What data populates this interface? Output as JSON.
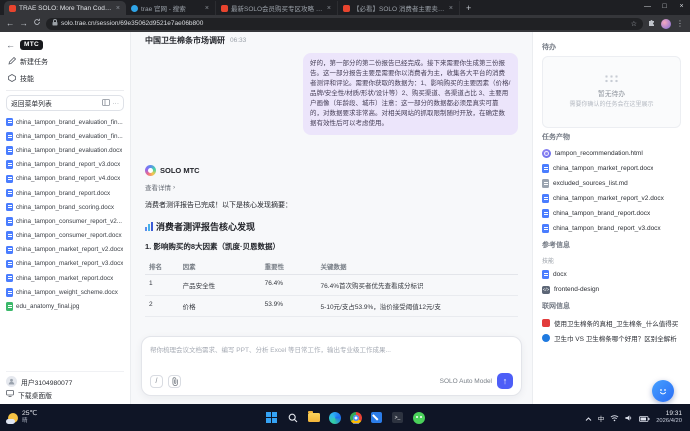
{
  "glyphs": {
    "back": "←",
    "forward": "→",
    "plus": "+",
    "min": "—",
    "max": "□",
    "close": "×",
    "more_v": "⋮",
    "more_h": "···",
    "chevron": "›",
    "up_arrow": "↑",
    "star": "☆",
    "slash": "/"
  },
  "browser": {
    "tabs": [
      {
        "title": "TRAE SOLO: More Than Coding"
      },
      {
        "title": "trae 官网 - 搜索"
      },
      {
        "title": "最新SOLO会员购买专区攻略 - TRAE..."
      },
      {
        "title": "【必看】SOLO 消费者主要卖点..."
      }
    ],
    "url": "solo.trae.cn/session/69e35062d9521e7ae06b800"
  },
  "sidebar": {
    "logo": "MTC",
    "new_task": "新建任务",
    "skills": "技能",
    "menu_button": "返回菜单列表",
    "files": [
      "china_tampon_brand_evaluation_fin...",
      "china_tampon_brand_evaluation_fin...",
      "china_tampon_brand_evaluation.docx",
      "china_tampon_brand_report_v3.docx",
      "china_tampon_brand_report_v4.docx",
      "china_tampon_brand_report.docx",
      "china_tampon_brand_scoring.docx",
      "china_tampon_consumer_report_v2...",
      "china_tampon_consumer_report.docx",
      "china_tampon_market_report_v2.docx",
      "china_tampon_market_report_v3.docx",
      "china_tampon_market_report.docx",
      "china_tampon_weight_scheme.docx",
      "edu_anatomy_final.jpg"
    ],
    "user": "用户3104980077",
    "download": "下载桌面版"
  },
  "chat": {
    "title": "中国卫生棉条市场调研",
    "time": "06:33",
    "user_message": "好的，第一部分的第二份报告已经完成。接下来需要你生成第三份报告。这一部分报告主要是需要你以消费者为主，收集各大平台的消费者测评和评论。需要你获取的数据为：1、影响购买的主要因素（价格/品牌/安全性/材质/形状/设计等）2、购买渠道、各渠道占比 3、主要用户画像（年龄段、城市）注意：这一部分的数据都必须是真实可靠的，对数据要求非常高。对相关网站的抓取限制随时开放，在确定数据有效性后可以考虑使用。",
    "agent_name": "SOLO MTC",
    "view_details": "查看详情",
    "summary_intro": "消费者测评报告已完成！以下是核心发现摘要：",
    "report_heading": "消费者测评报告核心发现",
    "section_heading": "1. 影响购买的8大因素（凯度·贝恩数据）",
    "table": {
      "headers": [
        "排名",
        "因素",
        "重要性",
        "关键数据"
      ],
      "rows": [
        [
          "1",
          "产品安全性",
          "76.4%",
          "76.4%首次购买者优先查看成分标识"
        ],
        [
          "2",
          "价格",
          "53.9%",
          "5-10元/支占53.9%，溢价接受阈值12元/支"
        ]
      ]
    },
    "input_placeholder": "帮你梳理会议文档需求、编写 PPT、分析 Excel 等日常工作，输出专业级工作成果...",
    "model_label": "SOLO Auto Model"
  },
  "panel": {
    "todo_title": "待办",
    "todo_empty": "暂无待办",
    "todo_hint": "需要你确认的任务会在这里展示",
    "artifacts_title": "任务产物",
    "artifacts": [
      "tampon_recommendation.html",
      "china_tampon_market_report.docx",
      "excluded_sources_list.md",
      "china_tampon_market_report_v2.docx",
      "china_tampon_brand_report.docx",
      "china_tampon_brand_report_v3.docx"
    ],
    "reference_title": "参考信息",
    "reference_group": "技能",
    "references": [
      "docx",
      "frontend-design"
    ],
    "web_title": "联网信息",
    "web_items": [
      "使用卫生棉条的真相_卫生棉条_什么值得买",
      "卫生巾 VS 卫生棉条哪个好用？区别全解析"
    ]
  },
  "taskbar": {
    "weather_temp": "25℃",
    "weather_desc": "晴",
    "ime": "中",
    "time": "19:31",
    "date": "2026/4/20"
  }
}
